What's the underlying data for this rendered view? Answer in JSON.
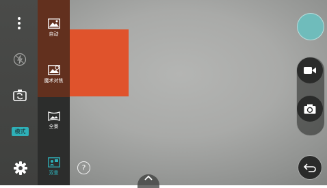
{
  "modes": [
    {
      "label": "自动",
      "icon": "auto-mode-icon"
    },
    {
      "label": "魔术对焦",
      "icon": "magic-focus-icon"
    },
    {
      "label": "全景",
      "icon": "panorama-icon"
    },
    {
      "label": "双重",
      "icon": "dual-camera-icon"
    }
  ],
  "left_rail": {
    "menu_icon": "more-vert-icon",
    "flash_icon": "flash-off-icon",
    "swap_icon": "switch-camera-icon",
    "mode_label": "模式",
    "settings_icon": "gear-icon"
  },
  "help": {
    "label": "?"
  },
  "right_rail": {
    "gallery_icon": "gallery-thumbnail",
    "video_icon": "video-record-icon",
    "shutter_icon": "camera-shutter-icon",
    "back_icon": "back-icon"
  },
  "colors": {
    "accent": "#2eb0b8",
    "selected_mode": "#62301e",
    "highlight": "#e0532c",
    "gallery": "#6fbcbb"
  }
}
